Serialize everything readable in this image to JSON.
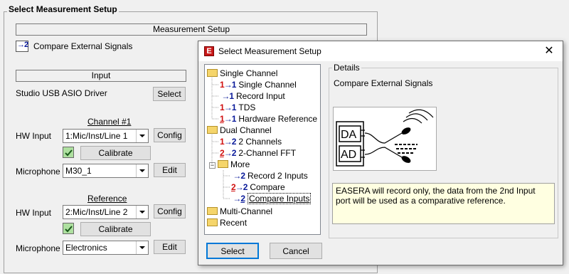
{
  "main": {
    "group_title": "Select Measurement Setup",
    "measurement_setup_header": "Measurement Setup",
    "current_setup": "Compare External Signals",
    "input_header": "Input",
    "driver_name": "Studio USB ASIO Driver",
    "select_button": "Select",
    "channel1": {
      "title": "Channel #1",
      "hw_input_label": "HW Input",
      "hw_input_value": "1:Mic/Inst/Line 1",
      "config_button": "Config",
      "calibrate_button": "Calibrate",
      "microphone_label": "Microphone",
      "microphone_value": "M30_1",
      "edit_button": "Edit"
    },
    "reference": {
      "title": "Reference",
      "hw_input_label": "HW Input",
      "hw_input_value": "2:Mic/Inst/Line 2",
      "config_button": "Config",
      "calibrate_button": "Calibrate",
      "microphone_label": "Microphone",
      "microphone_value": "Electronics",
      "edit_button": "Edit"
    }
  },
  "dialog": {
    "title": "Select Measurement Setup",
    "tree": {
      "single_channel": "Single Channel",
      "single_channel_item": "Single Channel",
      "record_input": "Record Input",
      "tds": "TDS",
      "hardware_reference": "Hardware Reference",
      "dual_channel": "Dual Channel",
      "two_channels": "2 Channels",
      "two_channel_fft": "2-Channel FFT",
      "more": "More",
      "record_2_inputs": "Record 2 Inputs",
      "compare": "Compare",
      "compare_inputs": "Compare Inputs",
      "multi_channel": "Multi-Channel",
      "recent": "Recent"
    },
    "details_label": "Details",
    "details_title": "Compare External Signals",
    "image_labels": {
      "da": "DA",
      "ad": "AD"
    },
    "description": "EASERA will record only, the data from the 2nd Input port will be used as a comparative reference.",
    "select_button": "Select",
    "cancel_button": "Cancel"
  }
}
